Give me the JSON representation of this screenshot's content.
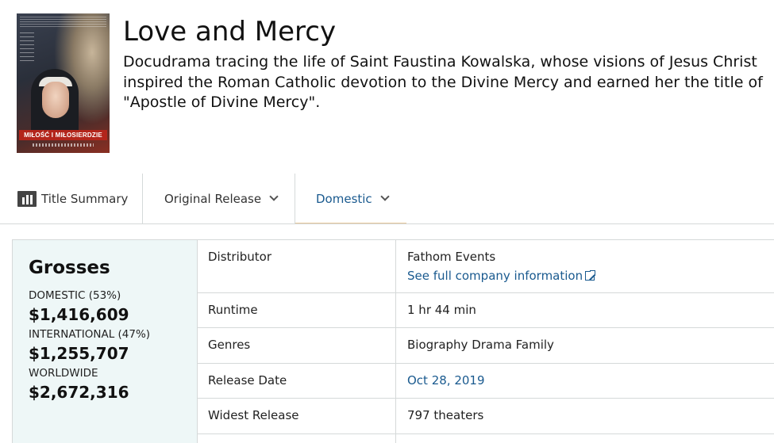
{
  "header": {
    "poster_text": "MIŁOŚĆ I MIŁOSIERDZIE",
    "title": "Love and Mercy",
    "synopsis": "Docudrama tracing the life of Saint Faustina Kowalska, whose visions of Jesus Christ inspired the Roman Catholic devotion to the Divine Mercy and earned her the title of \"Apostle of Divine Mercy\"."
  },
  "tabs": {
    "summary_label": "Title Summary",
    "original_label": "Original Release",
    "domestic_label": "Domestic"
  },
  "grosses": {
    "heading": "Grosses",
    "domestic_label": "DOMESTIC (53%)",
    "domestic_value": "$1,416,609",
    "international_label": "INTERNATIONAL (47%)",
    "international_value": "$1,255,707",
    "worldwide_label": "WORLDWIDE",
    "worldwide_value": "$2,672,316"
  },
  "details": {
    "distributor_label": "Distributor",
    "distributor_value": "Fathom Events",
    "distributor_link": "See full company information",
    "runtime_label": "Runtime",
    "runtime_value": "1 hr 44 min",
    "genres_label": "Genres",
    "genres_value": "Biography Drama Family",
    "release_label": "Release Date",
    "release_value": "Oct 28, 2019",
    "widest_label": "Widest Release",
    "widest_value": "797 theaters"
  },
  "colors": {
    "link": "#1a5a8f",
    "grosses_bg": "#eef7f7",
    "active_tab_underline": "#e8c89a"
  }
}
